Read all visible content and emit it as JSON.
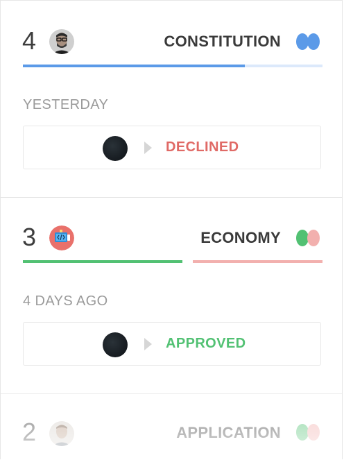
{
  "colors": {
    "blue": "#5b9ae8",
    "blue_light": "#dce9fb",
    "green": "#52c173",
    "pink": "#f2b0ae",
    "declined": "#e06a66",
    "approved": "#52c173"
  },
  "cards": [
    {
      "number": "4",
      "title": "CONSTITUTION",
      "avatar": "user-photo-icon",
      "when": "YESTERDAY",
      "vote_result": "DECLINED",
      "progress_yes": 0.75
    },
    {
      "number": "3",
      "title": "ECONOMY",
      "avatar": "code-laptop-icon",
      "when": "4 DAYS AGO",
      "vote_result": "APPROVED",
      "progress_yes": 0.53
    },
    {
      "number": "2",
      "title": "APPLICATION",
      "avatar": "user-photo-icon"
    }
  ]
}
